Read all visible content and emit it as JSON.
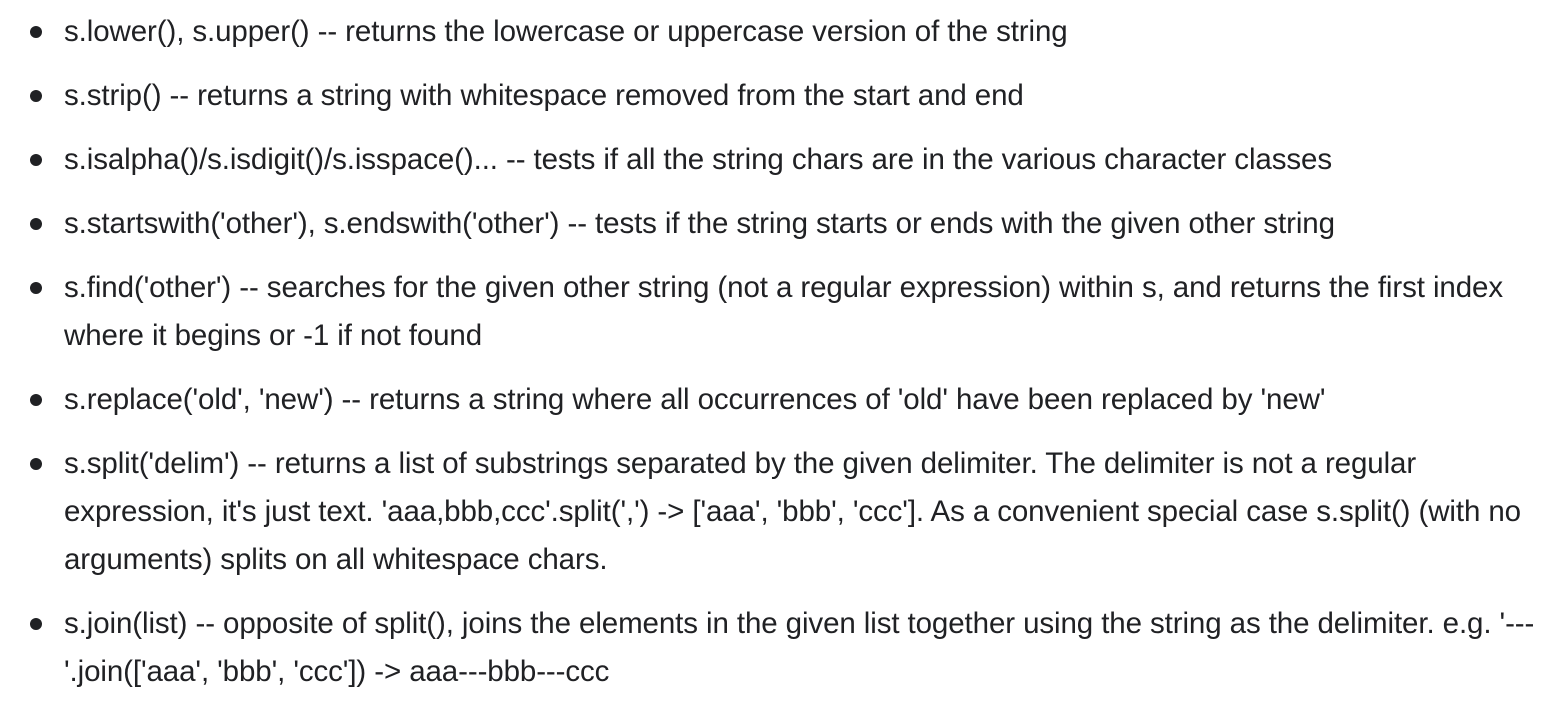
{
  "items": [
    {
      "text": "s.lower(), s.upper() -- returns the lowercase or uppercase version of the string"
    },
    {
      "text": "s.strip() -- returns a string with whitespace removed from the start and end"
    },
    {
      "text": "s.isalpha()/s.isdigit()/s.isspace()... -- tests if all the string chars are in the various character classes"
    },
    {
      "text": "s.startswith('other'), s.endswith('other') -- tests if the string starts or ends with the given other string"
    },
    {
      "text": "s.find('other') -- searches for the given other string (not a regular expression) within s, and returns the first index where it begins or -1 if not found"
    },
    {
      "text": "s.replace('old', 'new') -- returns a string where all occurrences of 'old' have been replaced by 'new'"
    },
    {
      "text": "s.split('delim') -- returns a list of substrings separated by the given delimiter. The delimiter is not a regular expression, it's just text. 'aaa,bbb,ccc'.split(',') -> ['aaa', 'bbb', 'ccc']. As a convenient special case s.split() (with no arguments) splits on all whitespace chars."
    },
    {
      "text": "s.join(list) -- opposite of split(), joins the elements in the given list together using the string as the delimiter. e.g. '---'.join(['aaa', 'bbb', 'ccc']) -> aaa---bbb---ccc"
    }
  ]
}
